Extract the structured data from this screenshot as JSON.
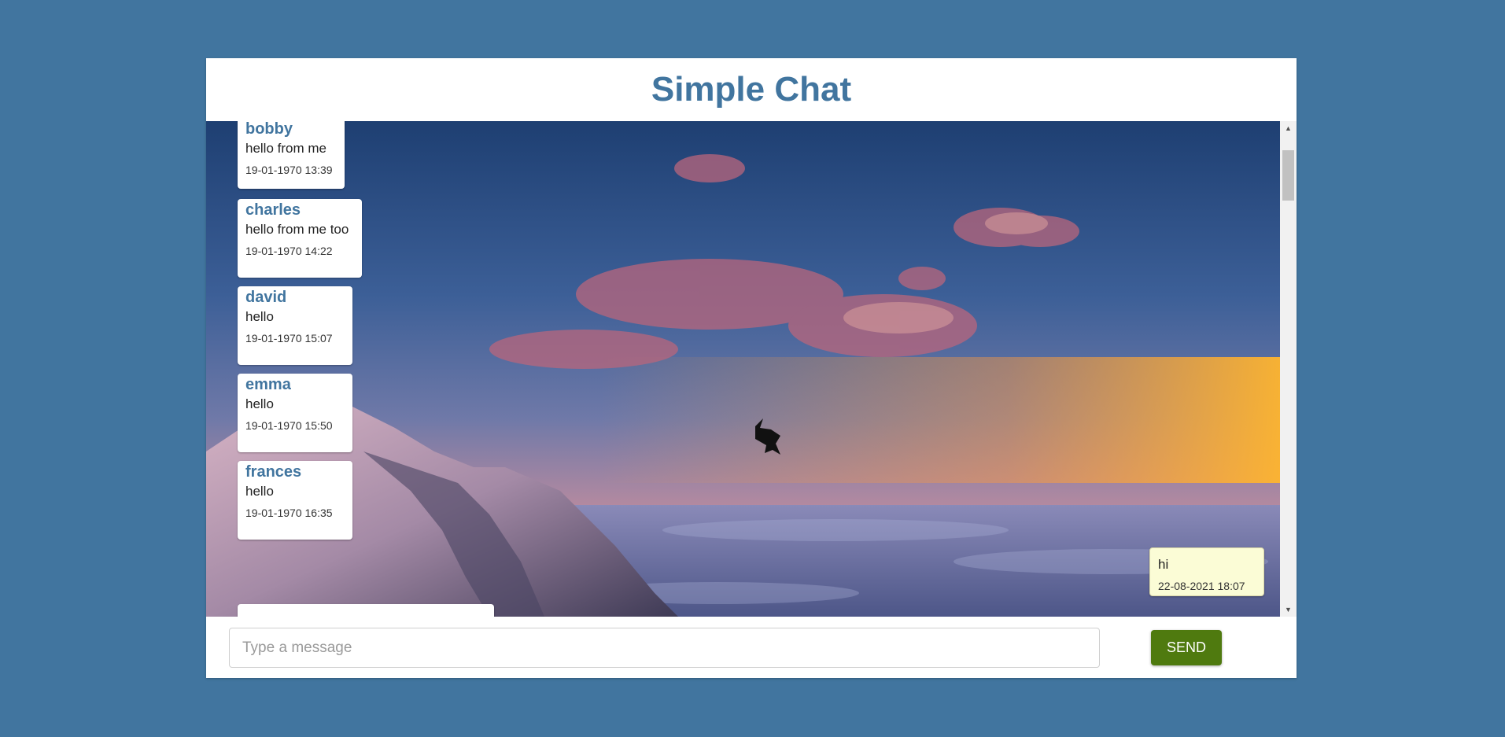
{
  "app": {
    "title": "Simple Chat"
  },
  "messages": [
    {
      "user": "bobby",
      "text": "hello from me",
      "time": "19-01-1970 13:39"
    },
    {
      "user": "charles",
      "text": "hello from me too",
      "time": "19-01-1970 14:22"
    },
    {
      "user": "david",
      "text": "hello",
      "time": "19-01-1970 15:07"
    },
    {
      "user": "emma",
      "text": "hello",
      "time": "19-01-1970 15:50"
    },
    {
      "user": "frances",
      "text": "hello",
      "time": "19-01-1970 16:35"
    }
  ],
  "own_message": {
    "text": "hi",
    "time": "22-08-2021 18:07"
  },
  "composer": {
    "placeholder": "Type a message",
    "value": "",
    "send_label": "SEND"
  },
  "colors": {
    "page_background": "#41759f",
    "title": "#41759f",
    "send_button": "#4f7a0f",
    "own_bubble": "#fbfcd6"
  },
  "icons": {
    "scroll_up": "triangle-up",
    "scroll_down": "triangle-down"
  }
}
